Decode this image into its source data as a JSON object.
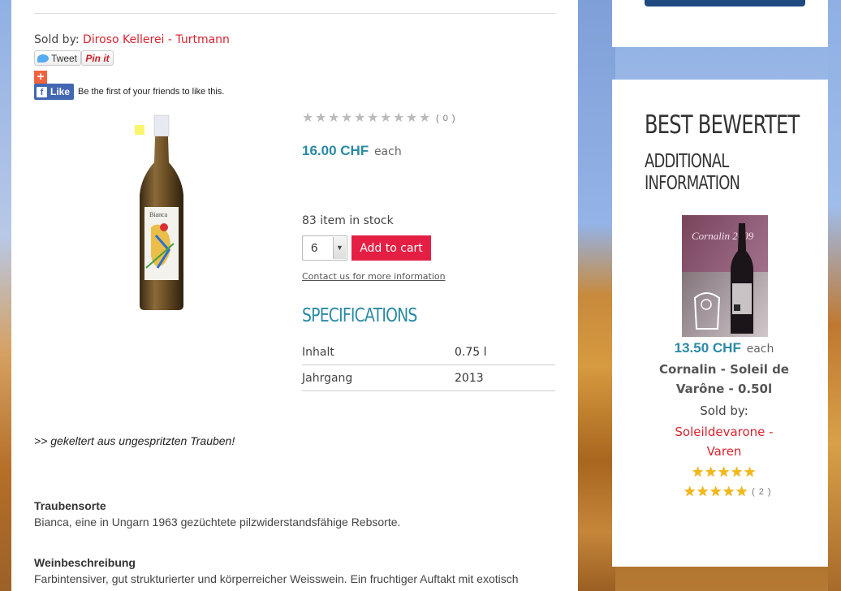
{
  "product": {
    "sold_by_label": "Sold by:",
    "seller_name": "Diroso Kellerei - Turtmann",
    "social": {
      "tweet_label": "Tweet",
      "pin_label": "Pin it",
      "plus_label": "+",
      "fb_like_label": "Like",
      "fb_text": "Be the first of your friends to like this."
    },
    "rating_count": "( 0 )",
    "price": "16.00 CHF",
    "price_unit": "each",
    "stock_text": "83 item in stock",
    "quantity": "6",
    "add_to_cart": "Add to cart",
    "contact_link": "Contact us for more information",
    "specifications_title": "SPECIFICATIONS",
    "specs": [
      {
        "key": "Inhalt",
        "value": "0.75 l"
      },
      {
        "key": "Jahrgang",
        "value": "2013"
      }
    ],
    "tagline": ">> gekeltert aus ungespritzten Trauben!",
    "sections": [
      {
        "title": "Traubensorte",
        "body": "Bianca, eine in Ungarn 1963 gezüchtete pilzwiderstandsfähige Rebsorte."
      },
      {
        "title": "Weinbeschreibung",
        "body": "Farbintensiver, gut strukturierter und körperreicher Weisswein. Ein fruchtiger Auftakt mit exotisch"
      }
    ],
    "bottle_label_text": "Bianca"
  },
  "sidebar": {
    "best_title": "BEST BEWERTET",
    "additional_info_line1": "ADDITIONAL",
    "additional_info_line2": "INFORMATION",
    "featured": {
      "image_caption": "Cornalin 2009",
      "price": "13.50 CHF",
      "price_unit": "each",
      "name_line1": "Cornalin - Soleil de",
      "name_line2": "Varône - 0.50l",
      "sold_by_label": "Sold by:",
      "seller_line1": "Soleildevarone -",
      "seller_line2": "Varen",
      "rating_count": "( 2 )"
    }
  },
  "colors": {
    "accent_blue": "#2a8aa4",
    "brand_red": "#e51f43",
    "link_red": "#d6242e"
  }
}
